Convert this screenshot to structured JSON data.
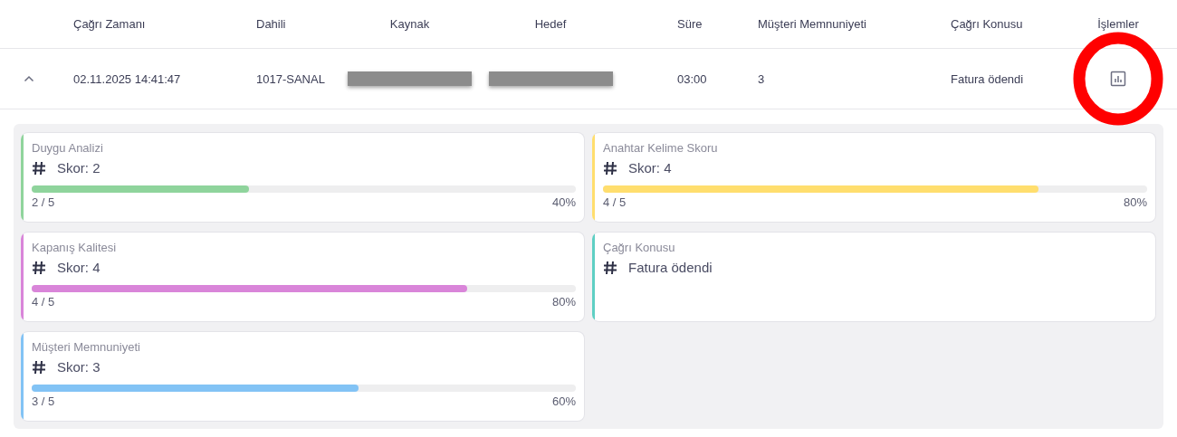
{
  "table": {
    "columns": [
      "Çağrı Zamanı",
      "Dahili",
      "Kaynak",
      "Hedef",
      "Süre",
      "Müşteri Memnuniyeti",
      "Çağrı Konusu",
      "İşlemler"
    ],
    "row": {
      "expanded": true,
      "time": "02.11.2025 14:41:47",
      "extension": "1017-SANAL",
      "source": {
        "redacted": true
      },
      "target": {
        "redacted": true
      },
      "duration": "03:00",
      "satisfaction": "3",
      "topic": "Fatura ödendi",
      "actions": {
        "highlighted": true
      }
    }
  },
  "details": [
    {
      "kind": "score",
      "title": "Duygu Analizi",
      "value": "Skor: 2",
      "level": 0.4,
      "fraction": "2 / 5",
      "percent": "40%",
      "color": "#8fd49c"
    },
    {
      "kind": "score",
      "title": "Anahtar Kelime Skoru",
      "value": "Skor: 4",
      "level": 0.8,
      "fraction": "4 / 5",
      "percent": "80%",
      "color": "#ffde6e"
    },
    {
      "kind": "score",
      "title": "Kapanış Kalitesi",
      "value": "Skor: 4",
      "level": 0.8,
      "fraction": "4 / 5",
      "percent": "80%",
      "color": "#d985d9"
    },
    {
      "kind": "text",
      "title": "Çağrı Konusu",
      "value": "Fatura ödendi",
      "color": "#5ecfc3"
    },
    {
      "kind": "score",
      "title": "Müşteri Memnuniyeti",
      "value": "Skor: 3",
      "level": 0.6,
      "fraction": "3 / 5",
      "percent": "60%",
      "color": "#82c3f5"
    }
  ]
}
